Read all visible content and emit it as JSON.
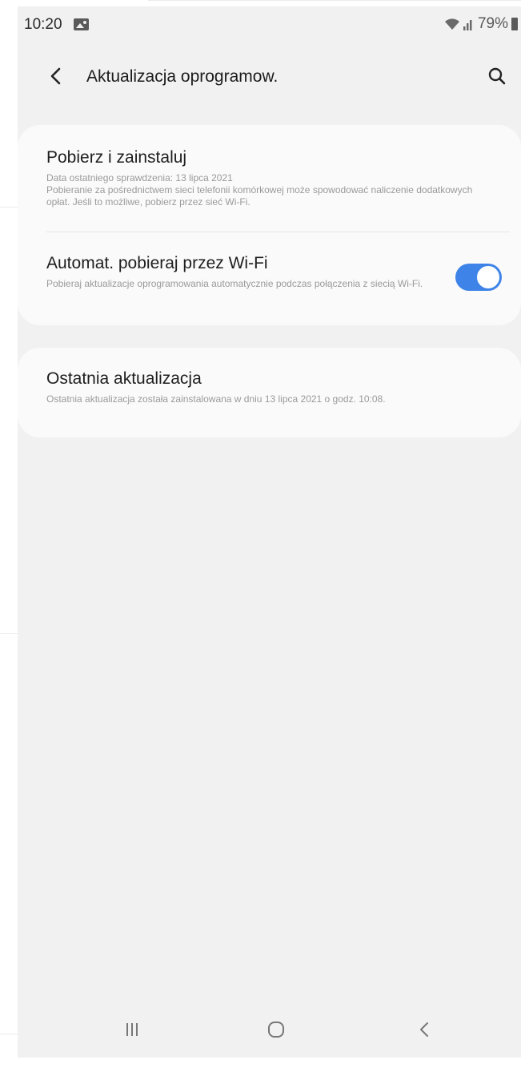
{
  "status_bar": {
    "time": "10:20",
    "battery": "79%",
    "icons": [
      "gallery-icon",
      "wifi-icon",
      "signal-icon",
      "battery-icon"
    ]
  },
  "toolbar": {
    "title": "Aktualizacja oprogramow.",
    "back_icon": "chevron-left-icon",
    "search_icon": "search-icon"
  },
  "settings": {
    "download": {
      "title": "Pobierz i zainstaluj",
      "subtitle_1": "Data ostatniego sprawdzenia: 13 lipca 2021",
      "subtitle_2": "Pobieranie za pośrednictwem sieci telefonii komórkowej może spowodować naliczenie dodatkowych opłat. Jeśli to możliwe, pobierz przez sieć Wi-Fi."
    },
    "auto_wifi": {
      "title": "Automat. pobieraj przez Wi-Fi",
      "subtitle": "Pobieraj aktualizacje oprogramowania automatycznie podczas połączenia z siecią Wi-Fi.",
      "enabled": true
    },
    "last_update": {
      "title": "Ostatnia aktualizacja",
      "subtitle": "Ostatnia aktualizacja została zainstalowana w dniu 13 lipca 2021 o godz. 10:08."
    }
  },
  "nav_bar": {
    "recents_icon": "recents-icon",
    "home_icon": "home-icon",
    "back_icon": "back-icon"
  },
  "colors": {
    "accent": "#3e84e8",
    "background": "#f1f1f1",
    "card": "#fafafa"
  }
}
